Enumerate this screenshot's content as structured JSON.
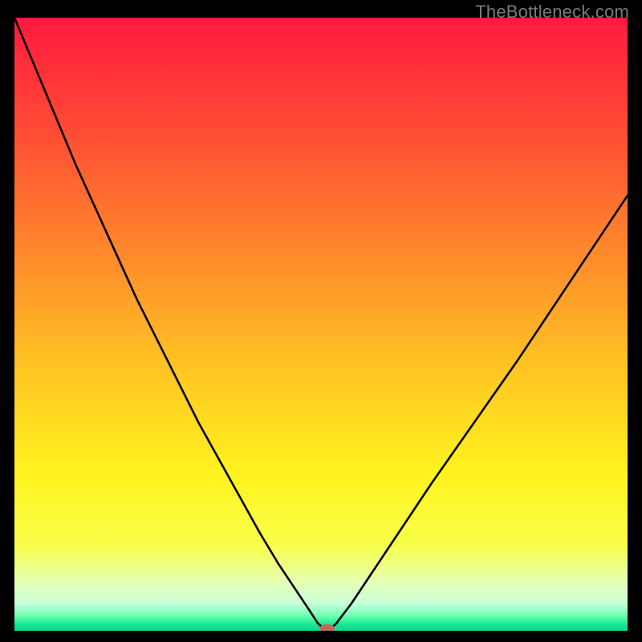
{
  "watermark": "TheBottleneck.com",
  "chart_data": {
    "type": "line",
    "title": "",
    "xlabel": "",
    "ylabel": "",
    "xlim": [
      0,
      100
    ],
    "ylim": [
      0,
      100
    ],
    "grid": false,
    "legend": false,
    "background_gradient_stops": [
      {
        "offset": 0.0,
        "color": "#ff1a3f"
      },
      {
        "offset": 0.18,
        "color": "#ff4a34"
      },
      {
        "offset": 0.4,
        "color": "#ff8e2b"
      },
      {
        "offset": 0.58,
        "color": "#ffc722"
      },
      {
        "offset": 0.75,
        "color": "#fff41f"
      },
      {
        "offset": 0.86,
        "color": "#f8ff4a"
      },
      {
        "offset": 0.92,
        "color": "#e7ffb3"
      },
      {
        "offset": 0.955,
        "color": "#c8ffda"
      },
      {
        "offset": 0.975,
        "color": "#72ffb6"
      },
      {
        "offset": 0.99,
        "color": "#12e893"
      },
      {
        "offset": 1.0,
        "color": "#0bdc8b"
      }
    ],
    "curve": {
      "x": [
        0,
        5,
        10,
        15,
        20,
        25,
        30,
        35,
        40,
        43,
        46,
        48,
        49.5,
        50.5,
        51.5,
        52.5,
        55,
        58,
        62,
        68,
        75,
        82,
        90,
        100
      ],
      "y": [
        100,
        88,
        76,
        65,
        54,
        44,
        34,
        25,
        16,
        11,
        6.5,
        3.5,
        1.2,
        0.3,
        0.3,
        1.2,
        4.5,
        9,
        15,
        24,
        34,
        44,
        56,
        71
      ]
    },
    "marker": {
      "x": 51,
      "y": 0.4,
      "rx": 1.2,
      "ry": 0.7,
      "color": "#c06a5c"
    }
  }
}
